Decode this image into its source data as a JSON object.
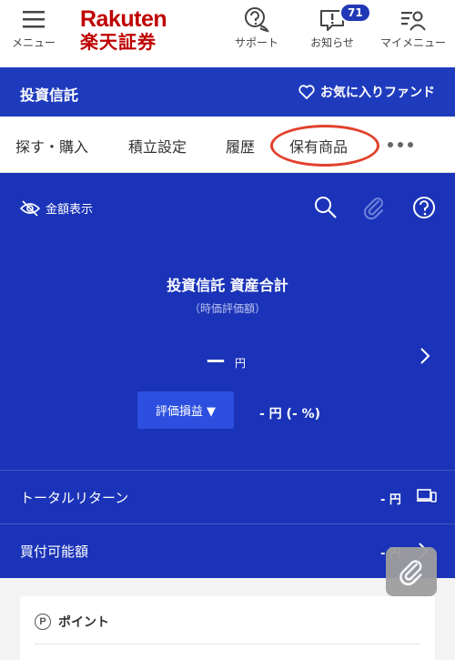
{
  "header": {
    "menu_label": "メニュー",
    "logo_en": "Rakuten",
    "logo_ja": "楽天証券",
    "support_label": "サポート",
    "notice_label": "お知らせ",
    "notice_count": "71",
    "mymenu_label": "マイメニュー",
    "brand_color": "#bf0000"
  },
  "section": {
    "title": "投資信託",
    "favorite_label": "お気に入りファンド",
    "color": "#1f3bbd"
  },
  "tabs": [
    {
      "label": "探す・購入"
    },
    {
      "label": "積立設定"
    },
    {
      "label": "履歴"
    },
    {
      "label": "保有商品"
    }
  ],
  "panel": {
    "amount_toggle_label": "金額表示",
    "asset_title": "投資信託 資産合計",
    "asset_subtitle": "（時価評価額）",
    "asset_value": "ー",
    "asset_unit": "円",
    "pl_button_label": "評価損益 ▼",
    "pl_value": "- 円 (- %)",
    "rows": [
      {
        "label": "トータルリターン",
        "value": "- 円"
      },
      {
        "label": "買付可能額",
        "value": "- 円"
      }
    ]
  },
  "card": {
    "title": "ポイント",
    "icon_letter": "P"
  }
}
